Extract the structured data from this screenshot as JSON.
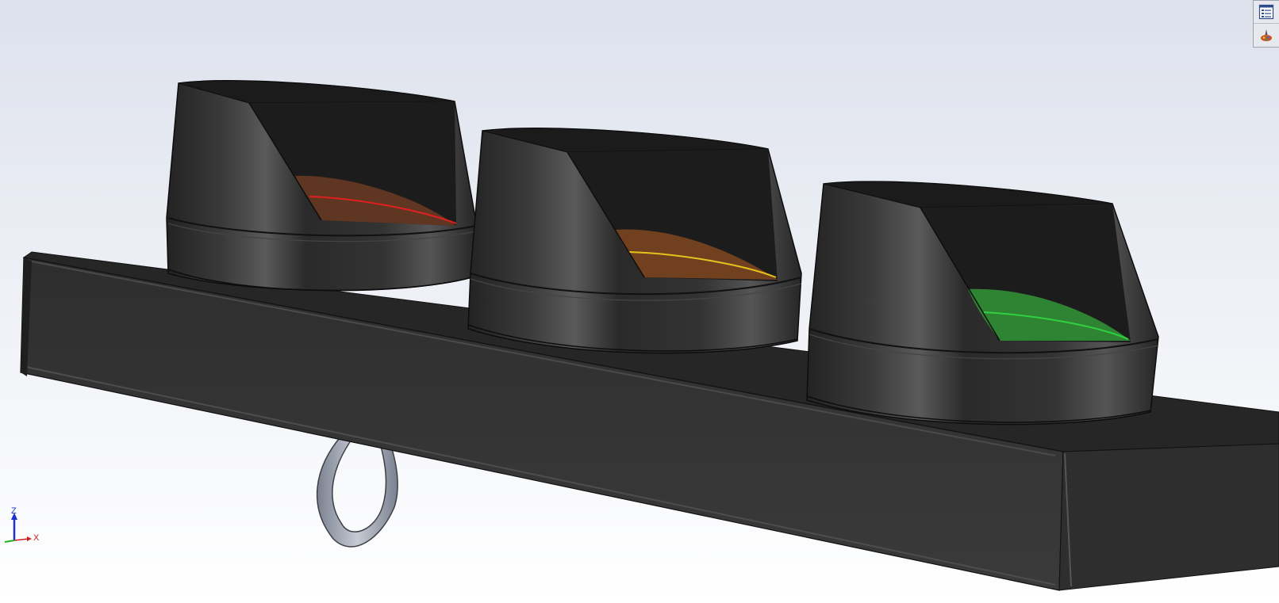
{
  "viewport": {
    "background_top": "#dde1ec",
    "background_bottom": "#ffffff"
  },
  "model": {
    "body_color": "#2c2c2c",
    "clip_color": "#8f95a3",
    "lights": [
      {
        "name": "red-light",
        "lens_color": "#6b3b22",
        "line_color": "#e02020"
      },
      {
        "name": "yellow-light",
        "lens_color": "#7a4520",
        "line_color": "#e6c21e"
      },
      {
        "name": "green-light",
        "lens_color": "#2f8a35",
        "line_color": "#32d040"
      }
    ]
  },
  "toolbar": {
    "buttons": [
      {
        "name": "feature-tree-toggle",
        "icon": "list-tree-icon"
      },
      {
        "name": "appearance-manager",
        "icon": "appearance-icon"
      }
    ]
  },
  "triad": {
    "z_label": "Z",
    "x_label": "X",
    "z_color": "#1f2fd0",
    "x_color": "#d02020",
    "y_color": "#20b020"
  }
}
